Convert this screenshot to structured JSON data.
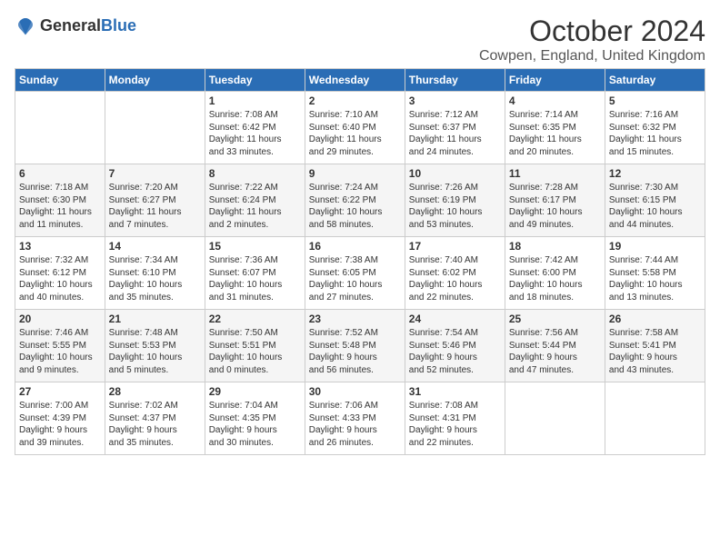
{
  "header": {
    "logo_general": "General",
    "logo_blue": "Blue",
    "month_title": "October 2024",
    "location": "Cowpen, England, United Kingdom"
  },
  "weekdays": [
    "Sunday",
    "Monday",
    "Tuesday",
    "Wednesday",
    "Thursday",
    "Friday",
    "Saturday"
  ],
  "weeks": [
    [
      {
        "day": "",
        "info": ""
      },
      {
        "day": "",
        "info": ""
      },
      {
        "day": "1",
        "info": "Sunrise: 7:08 AM\nSunset: 6:42 PM\nDaylight: 11 hours\nand 33 minutes."
      },
      {
        "day": "2",
        "info": "Sunrise: 7:10 AM\nSunset: 6:40 PM\nDaylight: 11 hours\nand 29 minutes."
      },
      {
        "day": "3",
        "info": "Sunrise: 7:12 AM\nSunset: 6:37 PM\nDaylight: 11 hours\nand 24 minutes."
      },
      {
        "day": "4",
        "info": "Sunrise: 7:14 AM\nSunset: 6:35 PM\nDaylight: 11 hours\nand 20 minutes."
      },
      {
        "day": "5",
        "info": "Sunrise: 7:16 AM\nSunset: 6:32 PM\nDaylight: 11 hours\nand 15 minutes."
      }
    ],
    [
      {
        "day": "6",
        "info": "Sunrise: 7:18 AM\nSunset: 6:30 PM\nDaylight: 11 hours\nand 11 minutes."
      },
      {
        "day": "7",
        "info": "Sunrise: 7:20 AM\nSunset: 6:27 PM\nDaylight: 11 hours\nand 7 minutes."
      },
      {
        "day": "8",
        "info": "Sunrise: 7:22 AM\nSunset: 6:24 PM\nDaylight: 11 hours\nand 2 minutes."
      },
      {
        "day": "9",
        "info": "Sunrise: 7:24 AM\nSunset: 6:22 PM\nDaylight: 10 hours\nand 58 minutes."
      },
      {
        "day": "10",
        "info": "Sunrise: 7:26 AM\nSunset: 6:19 PM\nDaylight: 10 hours\nand 53 minutes."
      },
      {
        "day": "11",
        "info": "Sunrise: 7:28 AM\nSunset: 6:17 PM\nDaylight: 10 hours\nand 49 minutes."
      },
      {
        "day": "12",
        "info": "Sunrise: 7:30 AM\nSunset: 6:15 PM\nDaylight: 10 hours\nand 44 minutes."
      }
    ],
    [
      {
        "day": "13",
        "info": "Sunrise: 7:32 AM\nSunset: 6:12 PM\nDaylight: 10 hours\nand 40 minutes."
      },
      {
        "day": "14",
        "info": "Sunrise: 7:34 AM\nSunset: 6:10 PM\nDaylight: 10 hours\nand 35 minutes."
      },
      {
        "day": "15",
        "info": "Sunrise: 7:36 AM\nSunset: 6:07 PM\nDaylight: 10 hours\nand 31 minutes."
      },
      {
        "day": "16",
        "info": "Sunrise: 7:38 AM\nSunset: 6:05 PM\nDaylight: 10 hours\nand 27 minutes."
      },
      {
        "day": "17",
        "info": "Sunrise: 7:40 AM\nSunset: 6:02 PM\nDaylight: 10 hours\nand 22 minutes."
      },
      {
        "day": "18",
        "info": "Sunrise: 7:42 AM\nSunset: 6:00 PM\nDaylight: 10 hours\nand 18 minutes."
      },
      {
        "day": "19",
        "info": "Sunrise: 7:44 AM\nSunset: 5:58 PM\nDaylight: 10 hours\nand 13 minutes."
      }
    ],
    [
      {
        "day": "20",
        "info": "Sunrise: 7:46 AM\nSunset: 5:55 PM\nDaylight: 10 hours\nand 9 minutes."
      },
      {
        "day": "21",
        "info": "Sunrise: 7:48 AM\nSunset: 5:53 PM\nDaylight: 10 hours\nand 5 minutes."
      },
      {
        "day": "22",
        "info": "Sunrise: 7:50 AM\nSunset: 5:51 PM\nDaylight: 10 hours\nand 0 minutes."
      },
      {
        "day": "23",
        "info": "Sunrise: 7:52 AM\nSunset: 5:48 PM\nDaylight: 9 hours\nand 56 minutes."
      },
      {
        "day": "24",
        "info": "Sunrise: 7:54 AM\nSunset: 5:46 PM\nDaylight: 9 hours\nand 52 minutes."
      },
      {
        "day": "25",
        "info": "Sunrise: 7:56 AM\nSunset: 5:44 PM\nDaylight: 9 hours\nand 47 minutes."
      },
      {
        "day": "26",
        "info": "Sunrise: 7:58 AM\nSunset: 5:41 PM\nDaylight: 9 hours\nand 43 minutes."
      }
    ],
    [
      {
        "day": "27",
        "info": "Sunrise: 7:00 AM\nSunset: 4:39 PM\nDaylight: 9 hours\nand 39 minutes."
      },
      {
        "day": "28",
        "info": "Sunrise: 7:02 AM\nSunset: 4:37 PM\nDaylight: 9 hours\nand 35 minutes."
      },
      {
        "day": "29",
        "info": "Sunrise: 7:04 AM\nSunset: 4:35 PM\nDaylight: 9 hours\nand 30 minutes."
      },
      {
        "day": "30",
        "info": "Sunrise: 7:06 AM\nSunset: 4:33 PM\nDaylight: 9 hours\nand 26 minutes."
      },
      {
        "day": "31",
        "info": "Sunrise: 7:08 AM\nSunset: 4:31 PM\nDaylight: 9 hours\nand 22 minutes."
      },
      {
        "day": "",
        "info": ""
      },
      {
        "day": "",
        "info": ""
      }
    ]
  ]
}
